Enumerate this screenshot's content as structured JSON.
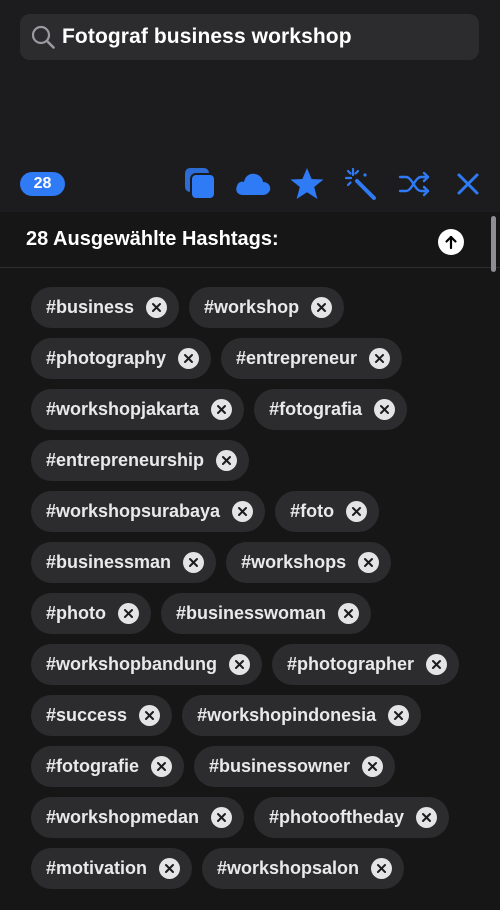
{
  "search": {
    "value": "Fotograf business workshop"
  },
  "toolbar": {
    "count": "28",
    "accent_color": "#2f7af5",
    "icons": [
      "copy-icon",
      "cloud-icon",
      "star-icon",
      "magic-wand-icon",
      "shuffle-icon",
      "close-icon"
    ]
  },
  "panel": {
    "title": "28 Ausgewählte Hashtags:",
    "tags": [
      "#business",
      "#workshop",
      "#photography",
      "#entrepreneur",
      "#workshopjakarta",
      "#fotografia",
      "#entrepreneurship",
      "#workshopsurabaya",
      "#foto",
      "#businessman",
      "#workshops",
      "#photo",
      "#businesswoman",
      "#workshopbandung",
      "#photographer",
      "#success",
      "#workshopindonesia",
      "#fotografie",
      "#businessowner",
      "#workshopmedan",
      "#photooftheday",
      "#motivation",
      "#workshopsalon"
    ]
  }
}
